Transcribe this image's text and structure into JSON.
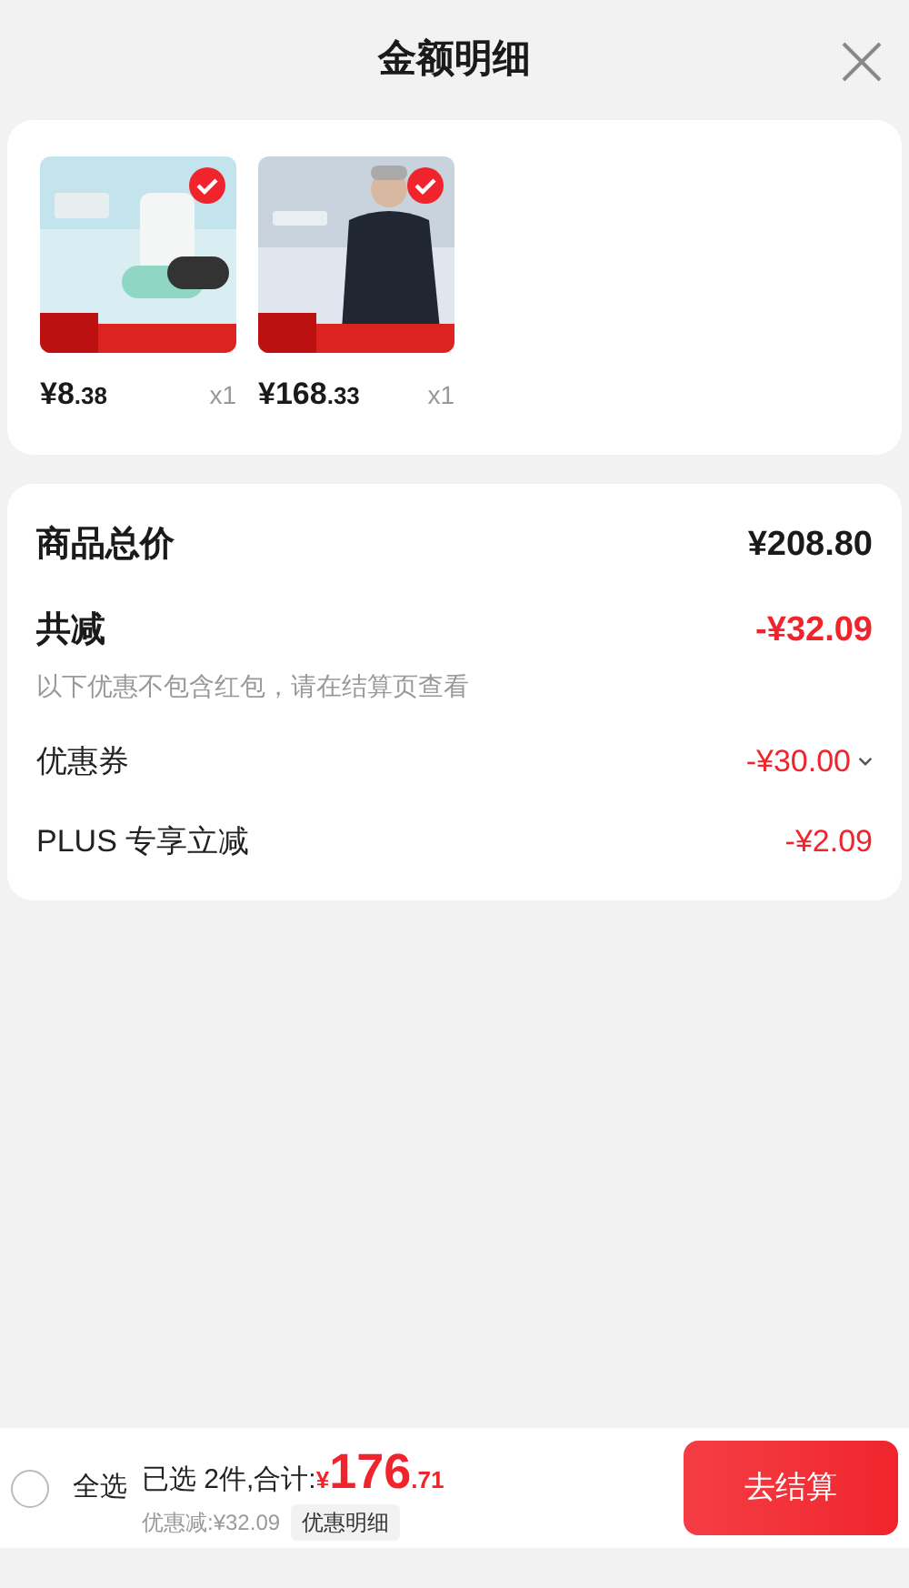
{
  "title": "金额明细",
  "products": [
    {
      "selected": true,
      "price_main": "¥8",
      "price_decimal": ".38",
      "quantity": "x1"
    },
    {
      "selected": true,
      "price_main": "¥168",
      "price_decimal": ".33",
      "quantity": "x1"
    }
  ],
  "summary": {
    "total_label": "商品总价",
    "total_value": "¥208.80",
    "discount_label": "共减",
    "discount_value": "-¥32.09",
    "note": "以下优惠不包含红包，请在结算页查看",
    "items": [
      {
        "label": "优惠券",
        "value": "-¥30.00",
        "expandable": true
      },
      {
        "label": "PLUS 专享立减",
        "value": "-¥2.09",
        "expandable": false
      }
    ]
  },
  "footer": {
    "select_all": {
      "label": "全选",
      "checked": false
    },
    "selected_text": "已选 2件,合计:",
    "currency": "¥",
    "total_main": "176",
    "total_decimal": ".71",
    "saved": "优惠减:¥32.09",
    "detail_link": "优惠明细",
    "checkout": "去结算"
  }
}
